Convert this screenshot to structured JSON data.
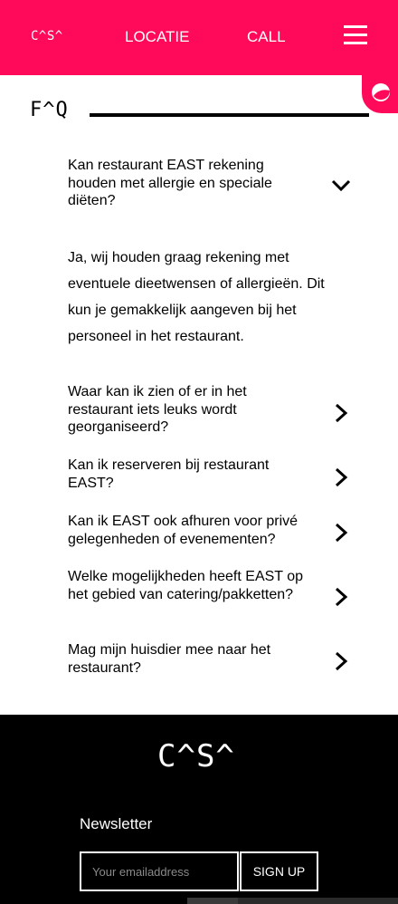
{
  "header": {
    "logo": "C^S^",
    "nav": {
      "locatie": "LOCATIE",
      "call": "CALL"
    },
    "menu_icon": "hamburger-menu-icon",
    "badge_icon": "contrast-circle-icon",
    "accent_color": "#ff0a5a"
  },
  "faq": {
    "title": "F^Q",
    "items": [
      {
        "question": "Kan restaurant EAST rekening houden met allergie en speciale diëten?",
        "expanded": true,
        "icon": "chevron-down-icon",
        "answer": "Ja, wij houden graag rekening met eventuele dieetwensen of allergieën. Dit kun je gemakkelijk aangeven bij het personeel in het restaurant."
      },
      {
        "question": "Waar kan ik zien of er in het restaurant iets leuks wordt georganiseerd?",
        "expanded": false,
        "icon": "chevron-right-icon"
      },
      {
        "question": "Kan ik reserveren bij restaurant EAST?",
        "expanded": false,
        "icon": "chevron-right-icon"
      },
      {
        "question": "Kan ik EAST ook afhuren voor privé gelegenheden of evenementen?",
        "expanded": false,
        "icon": "chevron-right-icon"
      },
      {
        "question": "Welke mogelijkheden heeft EAST op het gebied van catering/pakketten?",
        "expanded": false,
        "icon": "chevron-right-icon"
      },
      {
        "question": "Mag mijn huisdier mee naar het restaurant?",
        "expanded": false,
        "icon": "chevron-right-icon"
      }
    ]
  },
  "footer": {
    "logo": "C^S^",
    "newsletter_label": "Newsletter",
    "email_placeholder": "Your emailaddress",
    "email_value": "",
    "signup_label": "SIGN UP"
  }
}
